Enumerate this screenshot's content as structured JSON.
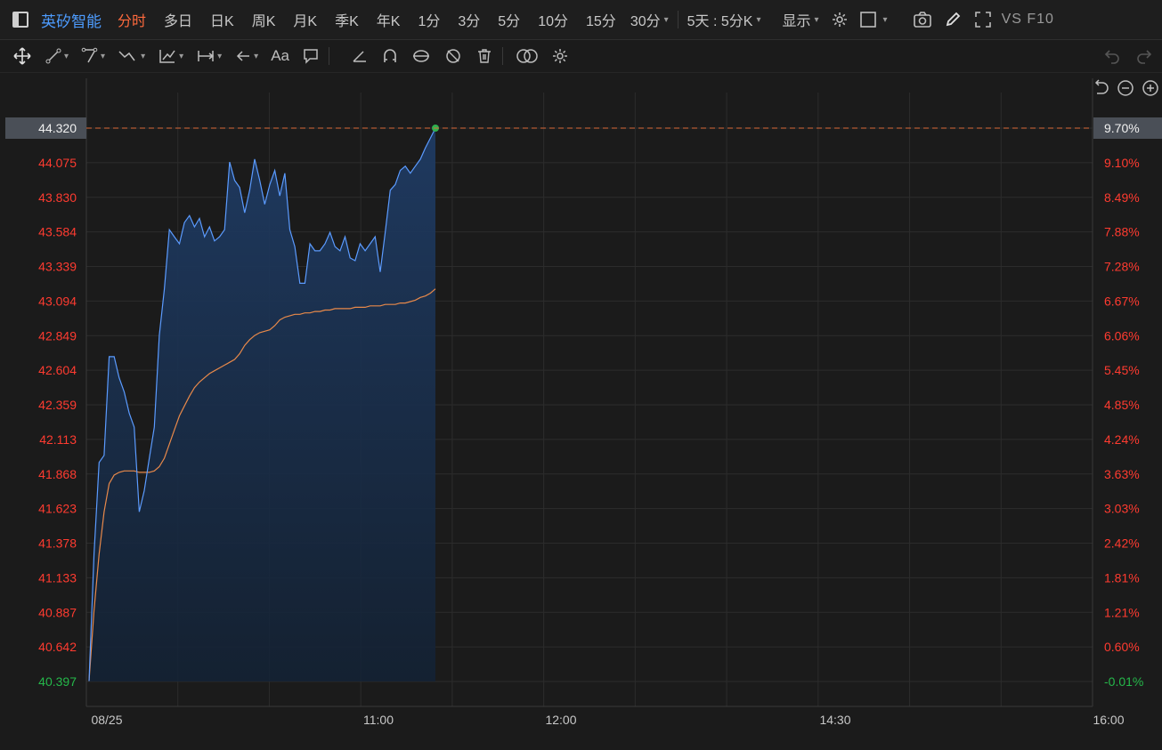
{
  "toolbar": {
    "stock_name": "英矽智能",
    "period_tabs": [
      "分时",
      "多日",
      "日K",
      "周K",
      "月K",
      "季K",
      "年K",
      "1分",
      "3分",
      "5分",
      "10分",
      "15分"
    ],
    "interval_dropdown": "30分",
    "multi_day_dropdown": "5天 : 5分K",
    "display_dropdown": "显示",
    "vs_label": "VS",
    "f10_label": "F10"
  },
  "drawing_tools": {
    "text_tool_label": "Aa"
  },
  "colors": {
    "background": "#1b1b1b",
    "grid": "#2c2c2c",
    "price_line": "#5b9bff",
    "avg_line": "#e8894a",
    "up_text": "#ff3b30",
    "down_text": "#25b84a",
    "ref_line": "#d9693a",
    "active_tab": "#ff6a3d",
    "name": "#4d9cff"
  },
  "chart_data": {
    "type": "area",
    "title": "",
    "x_axis_labels": [
      "08/25",
      "11:00",
      "12:00",
      "14:30",
      "16:00"
    ],
    "x_range": [
      0,
      54
    ],
    "ylim": [
      40.397,
      44.32
    ],
    "y_tick_labels": [
      "44.320",
      "44.075",
      "43.830",
      "43.584",
      "43.339",
      "43.094",
      "42.849",
      "42.604",
      "42.359",
      "42.113",
      "41.868",
      "41.623",
      "41.378",
      "41.133",
      "40.887",
      "40.642",
      "40.397"
    ],
    "pct_tick_labels": [
      "9.70%",
      "9.10%",
      "8.49%",
      "7.88%",
      "7.28%",
      "6.67%",
      "6.06%",
      "5.45%",
      "4.85%",
      "4.24%",
      "3.63%",
      "3.03%",
      "2.42%",
      "1.81%",
      "1.21%",
      "0.60%",
      "-0.01%"
    ],
    "current_price_label": "44.320",
    "current_pct_label": "9.70%",
    "series": [
      {
        "values": [
          40.4,
          41.3,
          41.95,
          42.0,
          42.7,
          42.7,
          42.55,
          42.45,
          42.3,
          42.2,
          41.6,
          41.75,
          41.98,
          42.2,
          42.85,
          43.18,
          43.6,
          43.55,
          43.5,
          43.65,
          43.7,
          43.62,
          43.68,
          43.55,
          43.62,
          43.52,
          43.55,
          43.6,
          44.08,
          43.95,
          43.9,
          43.72,
          43.88,
          44.1,
          43.95,
          43.78,
          43.92,
          44.02,
          43.84,
          44.0,
          43.6,
          43.48,
          43.22,
          43.22,
          43.5,
          43.45,
          43.45,
          43.5,
          43.58,
          43.48,
          43.45,
          43.55,
          43.4,
          43.38,
          43.5,
          43.45,
          43.5,
          43.55,
          43.3,
          43.58,
          43.88,
          43.92,
          44.02,
          44.05,
          44.0,
          44.05,
          44.1,
          44.18,
          44.25,
          44.32
        ]
      },
      {
        "values": [
          40.4,
          40.9,
          41.3,
          41.6,
          41.8,
          41.86,
          41.88,
          41.89,
          41.89,
          41.89,
          41.88,
          41.88,
          41.88,
          41.89,
          41.92,
          41.98,
          42.08,
          42.18,
          42.28,
          42.35,
          42.42,
          42.48,
          42.52,
          42.55,
          42.58,
          42.6,
          42.62,
          42.64,
          42.66,
          42.68,
          42.72,
          42.78,
          42.82,
          42.85,
          42.87,
          42.88,
          42.89,
          42.92,
          42.96,
          42.98,
          42.99,
          43.0,
          43.0,
          43.01,
          43.01,
          43.02,
          43.02,
          43.03,
          43.03,
          43.04,
          43.04,
          43.04,
          43.04,
          43.05,
          43.05,
          43.05,
          43.06,
          43.06,
          43.06,
          43.07,
          43.07,
          43.07,
          43.08,
          43.08,
          43.09,
          43.1,
          43.12,
          43.13,
          43.15,
          43.18
        ]
      }
    ]
  }
}
